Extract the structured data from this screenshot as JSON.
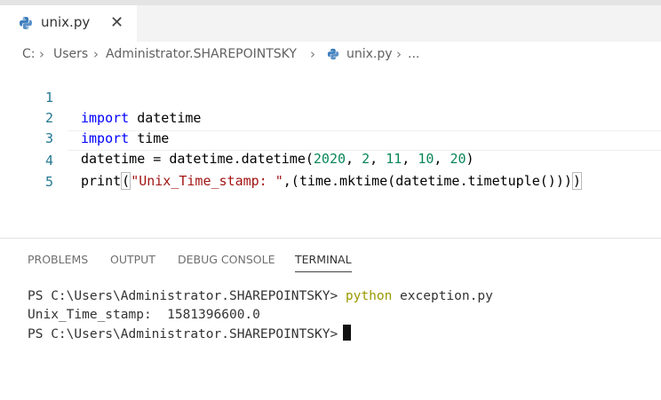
{
  "tab": {
    "filename": "unix.py",
    "close_glyph": "✕"
  },
  "breadcrumb": {
    "items": [
      "C:",
      "Users",
      "Administrator.SHAREPOINTSKY",
      "unix.py",
      "..."
    ],
    "separator": ">"
  },
  "editor": {
    "line_numbers": [
      "1",
      "2",
      "3",
      "4",
      "5"
    ],
    "lines": {
      "l1_kw": "import",
      "l1_rest": " datetime",
      "l2_kw": "import",
      "l2_rest": " time",
      "l3_a": "datetime = datetime.datetime(",
      "l3_n1": "2020",
      "l3_c1": ", ",
      "l3_n2": "2",
      "l3_c2": ", ",
      "l3_n3": "11",
      "l3_c3": ", ",
      "l3_n4": "10",
      "l3_c4": ", ",
      "l3_n5": "20",
      "l3_end": ")",
      "l4_a": "print",
      "l4_open": "(",
      "l4_str": "\"Unix_Time_stamp: \"",
      "l4_mid": ",(time.mktime(datetime.timetuple()))",
      "l4_close": ")"
    }
  },
  "panel": {
    "tabs": [
      "PROBLEMS",
      "OUTPUT",
      "DEBUG CONSOLE",
      "TERMINAL"
    ],
    "active_tab": "TERMINAL",
    "terminal": {
      "prompt1": "PS C:\\Users\\Administrator.SHAREPOINTSKY> ",
      "cmd": "python",
      "cmd_arg": " exception.py",
      "output": "Unix_Time_stamp:  1581396600.0",
      "prompt2": "PS C:\\Users\\Administrator.SHAREPOINTSKY>"
    }
  },
  "colors": {
    "keyword": "#0000ff",
    "number": "#098658",
    "string": "#a31515",
    "line_number": "#237893",
    "terminal_command": "#999900"
  },
  "icons": [
    "python-file-icon",
    "close-icon",
    "chevron-right-icon",
    "terminal-cursor"
  ]
}
